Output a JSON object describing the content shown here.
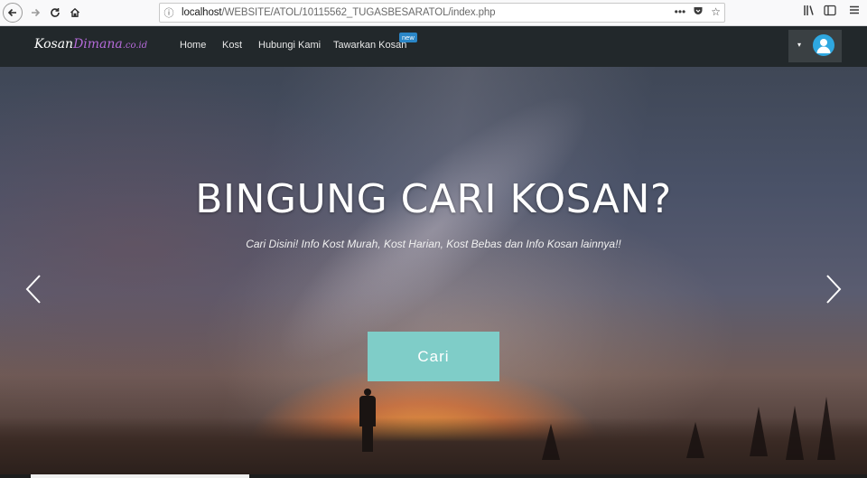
{
  "browser": {
    "back_icon": "arrow-left-icon",
    "forward_icon": "arrow-right-icon",
    "reload_icon": "reload-icon",
    "home_icon": "home-icon",
    "url_prefix": "localhost",
    "url_path": "/WEBSITE/ATOL/10115562_TUGASBESARATOL/index.php",
    "menu_dots": "•••"
  },
  "navbar": {
    "brand_part1": "Kosan",
    "brand_part2": "Dimana",
    "brand_part3": ".co.id",
    "items": [
      {
        "label": "Home"
      },
      {
        "label": "Kost"
      },
      {
        "label": "Hubungi Kami"
      },
      {
        "label": "Tawarkan Kosan"
      }
    ],
    "new_badge": "new",
    "caret": "▾"
  },
  "hero": {
    "title": "BINGUNG CARI KOSAN?",
    "subtitle": "Cari Disini! Info Kost Murah, Kost Harian, Kost Bebas dan Info Kosan lainnya!!",
    "prev": "‹",
    "next": "›",
    "button_label": "Cari"
  }
}
